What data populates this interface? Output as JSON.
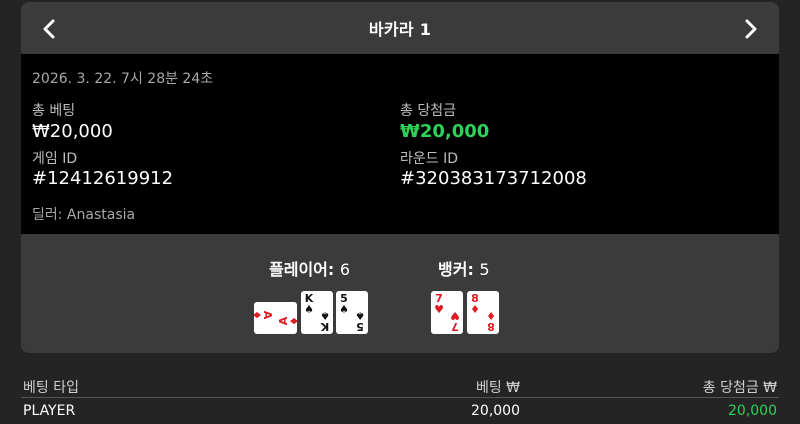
{
  "header": {
    "title": "바카라 1"
  },
  "info": {
    "datetime": "2026. 3. 22. 7시 28분 24초",
    "total_bet_label": "총 베팅",
    "total_bet_value": "₩20,000",
    "total_win_label": "총 당첨금",
    "total_win_value": "₩20,000",
    "game_id_label": "게임 ID",
    "game_id_value": "#12412619912",
    "round_id_label": "라운드 ID",
    "round_id_value": "#320383173712008",
    "dealer": "딜러: Anastasia"
  },
  "result": {
    "player_label": "플레이어:",
    "player_score": "6",
    "banker_label": "뱅커:",
    "banker_score": "5",
    "player_cards": [
      {
        "rank": "A",
        "suit": "♦",
        "color": "#e01b24",
        "rotated": true
      },
      {
        "rank": "K",
        "suit": "♠",
        "color": "#111111",
        "rotated": false
      },
      {
        "rank": "5",
        "suit": "♠",
        "color": "#111111",
        "rotated": false
      }
    ],
    "banker_cards": [
      {
        "rank": "7",
        "suit": "♥",
        "color": "#e01b24",
        "rotated": false
      },
      {
        "rank": "8",
        "suit": "♦",
        "color": "#e01b24",
        "rotated": false
      }
    ]
  },
  "table": {
    "headers": [
      "베팅 타입",
      "베팅 ₩",
      "총 당첨금 ₩"
    ],
    "rows": [
      {
        "type": "PLAYER",
        "bet": "20,000",
        "win": "20,000"
      }
    ]
  },
  "colors": {
    "win_green": "#2fd158",
    "card_red": "#e01b24"
  }
}
